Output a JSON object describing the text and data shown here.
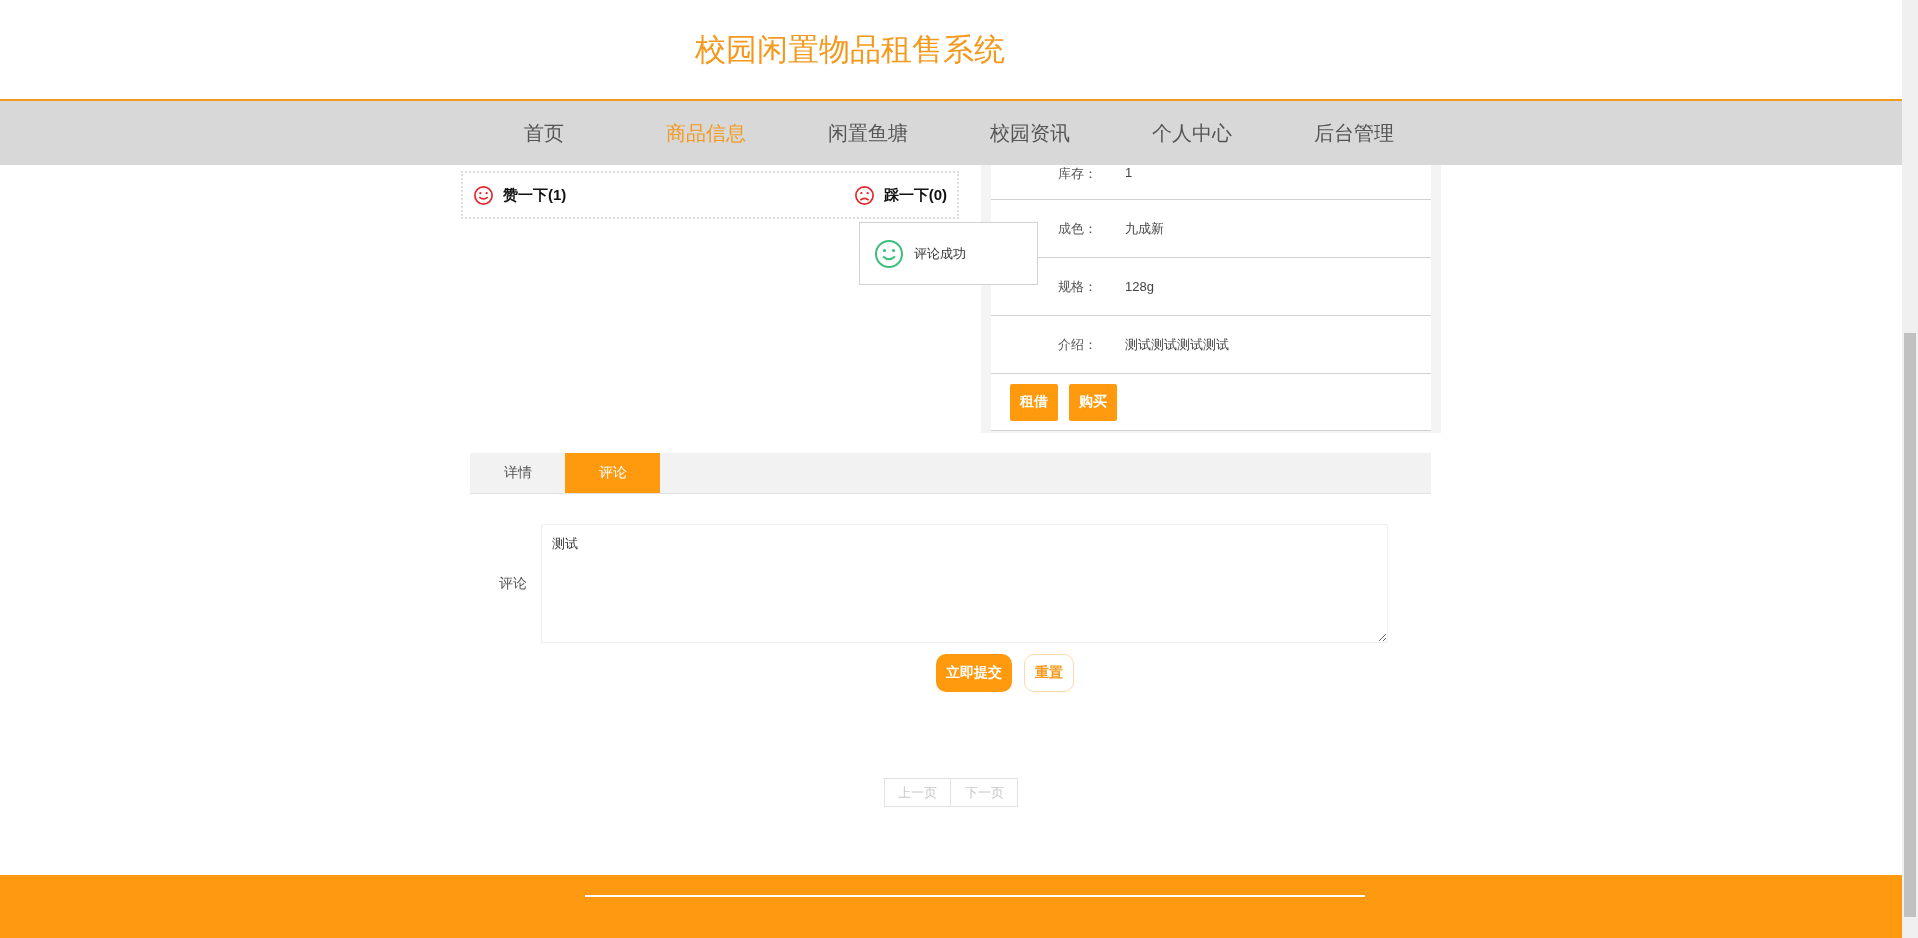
{
  "header": {
    "title": "校园闲置物品租售系统"
  },
  "nav": [
    {
      "label": "首页",
      "selected": false
    },
    {
      "label": "商品信息",
      "selected": true
    },
    {
      "label": "闲置鱼塘",
      "selected": false
    },
    {
      "label": "校园资讯",
      "selected": false
    },
    {
      "label": "个人中心",
      "selected": false
    },
    {
      "label": "后台管理",
      "selected": false
    }
  ],
  "votes": [
    {
      "kind": "like",
      "label": "赞一下(1)"
    },
    {
      "kind": "dislike",
      "label": "踩一下(0)"
    }
  ],
  "toast": {
    "message": "评论成功"
  },
  "details": [
    {
      "label": "库存：",
      "value": "1"
    },
    {
      "label": "成色：",
      "value": "九成新"
    },
    {
      "label": "规格：",
      "value": "128g"
    },
    {
      "label": "介绍：",
      "value": "测试测试测试测试"
    }
  ],
  "actions": [
    "租借",
    "购买"
  ],
  "tabs": [
    {
      "label": "详情",
      "selected": false
    },
    {
      "label": "评论",
      "selected": true
    }
  ],
  "comment_form": {
    "label": "评论",
    "value": "测试",
    "buttons": [
      {
        "kind": "primary",
        "label": "立即提交"
      },
      {
        "kind": "plain",
        "label": "重置"
      }
    ]
  },
  "pagination": [
    {
      "label": "上一页",
      "disabled": true
    },
    {
      "label": "下一页",
      "disabled": true
    }
  ]
}
